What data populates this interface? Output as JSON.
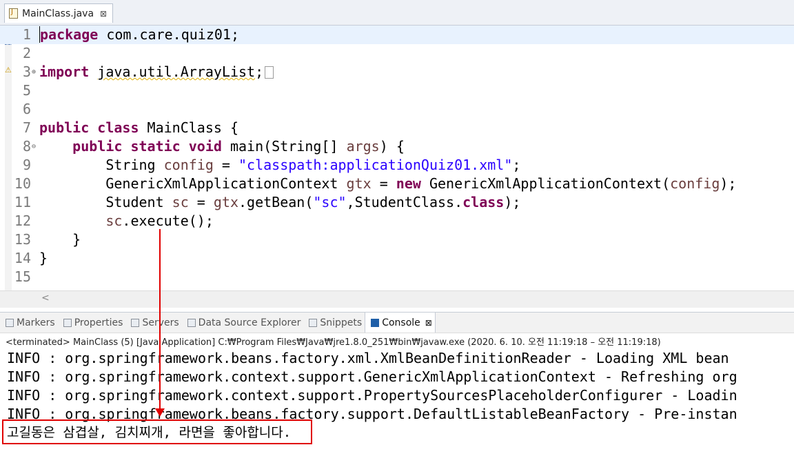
{
  "editor": {
    "tab_label": "MainClass.java",
    "tab_close": "⊠",
    "lines": [
      {
        "n": "1",
        "html": "<span class=\"caret\"></span><span class=\"kw\">package</span> com.care.quiz01;",
        "current": true
      },
      {
        "n": "2",
        "html": ""
      },
      {
        "n": "3",
        "fold": "⊕",
        "html": "<span class=\"kw\">import</span> <span class=\"warn-underline\">java.util.ArrayList</span>;<span class=\"collapsed-box\"></span>"
      },
      {
        "n": "5",
        "html": ""
      },
      {
        "n": "6",
        "html": ""
      },
      {
        "n": "7",
        "html": "<span class=\"kw\">public</span> <span class=\"kw\">class</span> MainClass {"
      },
      {
        "n": "8",
        "fold": "⊖",
        "html": "    <span class=\"kw\">public</span> <span class=\"kw\">static</span> <span class=\"kw\">void</span> main(String[] <span class=\"var\">args</span>) {"
      },
      {
        "n": "9",
        "html": "        String <span class=\"var\">config</span> = <span class=\"str\">\"classpath:applicationQuiz01.xml\"</span>;"
      },
      {
        "n": "10",
        "html": "        GenericXmlApplicationContext <span class=\"var\">gtx</span> = <span class=\"kw\">new</span> GenericXmlApplicationContext(<span class=\"var\">config</span>);"
      },
      {
        "n": "11",
        "html": "        Student <span class=\"var\">sc</span> = <span class=\"var\">gtx</span>.getBean(<span class=\"str\">\"sc\"</span>,StudentClass.<span class=\"kw\">class</span>);"
      },
      {
        "n": "12",
        "html": "        <span class=\"var\">sc</span>.execute();"
      },
      {
        "n": "13",
        "html": "    }"
      },
      {
        "n": "14",
        "html": "}"
      },
      {
        "n": "15",
        "html": ""
      }
    ],
    "scroll_left": "<"
  },
  "panel": {
    "tabs": [
      {
        "label": "Markers",
        "icon": "markers-icon",
        "active": false
      },
      {
        "label": "Properties",
        "icon": "properties-icon",
        "active": false
      },
      {
        "label": "Servers",
        "icon": "servers-icon",
        "active": false
      },
      {
        "label": "Data Source Explorer",
        "icon": "data-source-icon",
        "active": false
      },
      {
        "label": "Snippets",
        "icon": "snippets-icon",
        "active": false
      },
      {
        "label": "Console",
        "icon": "console-icon",
        "active": true
      }
    ],
    "console_close": "⊠"
  },
  "console": {
    "header": "<terminated> MainClass (5) [Java Application] C:₩Program Files₩Java₩jre1.8.0_251₩bin₩javaw.exe  (2020. 6. 10. 오전 11:19:18 – 오전 11:19:18)",
    "lines": [
      "INFO : org.springframework.beans.factory.xml.XmlBeanDefinitionReader - Loading XML bean",
      "INFO : org.springframework.context.support.GenericXmlApplicationContext - Refreshing org",
      "INFO : org.springframework.context.support.PropertySourcesPlaceholderConfigurer - Loadin",
      "INFO : org.springframework.beans.factory.support.DefaultListableBeanFactory - Pre-instan"
    ],
    "output": "고길동은 삼겹살, 김치찌개, 라면을 좋아합니다."
  },
  "colors": {
    "annotation": "#e00000",
    "keyword": "#7f0055",
    "string": "#2a00ff",
    "variable": "#6a3e3e"
  }
}
